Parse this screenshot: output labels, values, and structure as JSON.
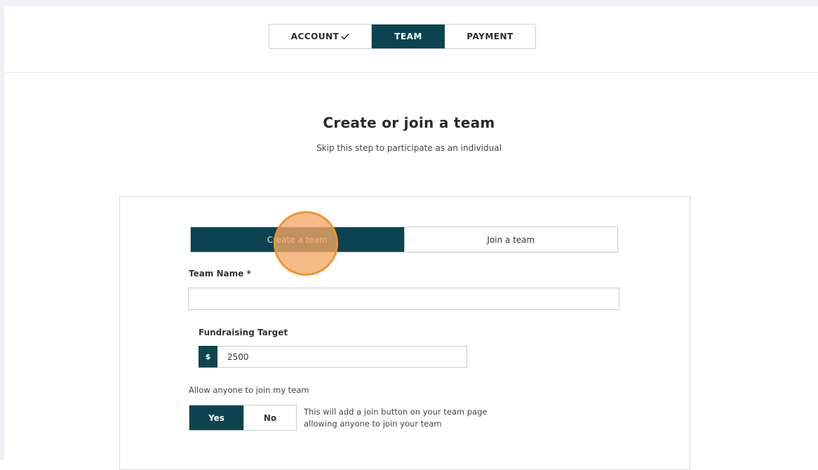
{
  "steps": [
    {
      "label": "ACCOUNT",
      "state": "completed",
      "icon": "check-icon"
    },
    {
      "label": "TEAM",
      "state": "active"
    },
    {
      "label": "PAYMENT",
      "state": "upcoming"
    }
  ],
  "page": {
    "title": "Create or join a team",
    "subtitle": "Skip this step to participate as an individual"
  },
  "team_mode": {
    "create_label": "Create a team",
    "join_label": "Join a team",
    "selected": "Create a team"
  },
  "form": {
    "team_name_label": "Team Name *",
    "team_name_value": "",
    "target_label": "Fundraising Target",
    "currency_symbol": "$",
    "target_value": "2500",
    "allow_label": "Allow anyone to join my team",
    "yes_label": "Yes",
    "no_label": "No",
    "allow_selected": "Yes",
    "allow_helper": "This will add a join button on your team page allowing anyone to join your team"
  },
  "colors": {
    "accent": "#0b4450",
    "click_highlight": "#f2922d"
  }
}
